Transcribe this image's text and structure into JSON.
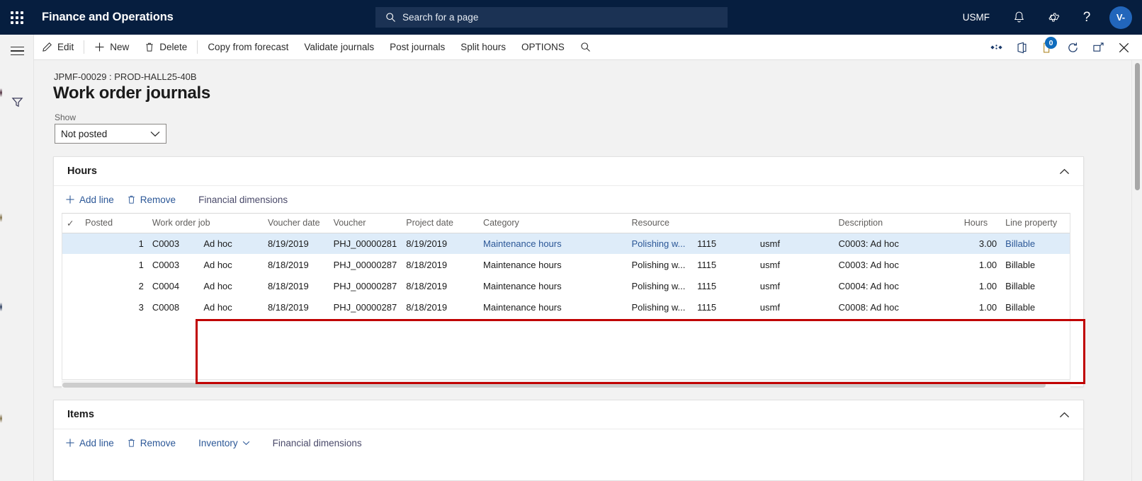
{
  "topnav": {
    "app_title": "Finance and Operations",
    "search_placeholder": "Search for a page",
    "company": "USMF",
    "icons": [
      "waffle-icon",
      "search-icon",
      "bell-icon",
      "gear-icon",
      "help-icon"
    ],
    "avatar_initials": "V-"
  },
  "commandbar": {
    "items": [
      {
        "label": "Edit",
        "icon": "pencil-icon"
      },
      {
        "label": "New",
        "icon": "plus-icon"
      },
      {
        "label": "Delete",
        "icon": "trash-icon"
      },
      {
        "label": "Copy from forecast",
        "icon": ""
      },
      {
        "label": "Validate journals",
        "icon": ""
      },
      {
        "label": "Post journals",
        "icon": ""
      },
      {
        "label": "Split hours",
        "icon": ""
      },
      {
        "label": "OPTIONS",
        "icon": ""
      }
    ],
    "right_icons": [
      "attachments-icon",
      "office-icon",
      "notes-icon",
      "refresh-icon",
      "popout-icon",
      "close-icon"
    ],
    "notes_badge": "0"
  },
  "page": {
    "breadcrumb": "JPMF-00029 : PROD-HALL25-40B",
    "title": "Work order journals",
    "show_label": "Show",
    "show_value": "Not posted"
  },
  "hours_section": {
    "title": "Hours",
    "toolbar": [
      {
        "label": "Add line",
        "icon": "plus-icon"
      },
      {
        "label": "Remove",
        "icon": "trash-icon"
      },
      {
        "label": "Financial dimensions",
        "icon": ""
      }
    ],
    "columns": [
      {
        "key": "check",
        "label": "✓"
      },
      {
        "key": "posted",
        "label": "Posted"
      },
      {
        "key": "line",
        "label": ""
      },
      {
        "key": "job",
        "label": "Work order job"
      },
      {
        "key": "adhoc",
        "label": ""
      },
      {
        "key": "voucher_date",
        "label": "Voucher date"
      },
      {
        "key": "voucher",
        "label": "Voucher"
      },
      {
        "key": "project_date",
        "label": "Project date"
      },
      {
        "key": "category",
        "label": "Category"
      },
      {
        "key": "resource",
        "label": "Resource"
      },
      {
        "key": "resource_num",
        "label": ""
      },
      {
        "key": "legal_entity",
        "label": ""
      },
      {
        "key": "description",
        "label": "Description"
      },
      {
        "key": "hours",
        "label": "Hours"
      },
      {
        "key": "line_property",
        "label": "Line property"
      }
    ],
    "rows": [
      {
        "selected": true,
        "line": "1",
        "job": "C0003",
        "adhoc": "Ad hoc",
        "voucher_date": "8/19/2019",
        "voucher": "PHJ_00000281",
        "project_date": "8/19/2019",
        "category": "Maintenance hours",
        "resource": "Polishing w...",
        "resource_num": "1115",
        "legal_entity": "usmf",
        "description": "C0003: Ad hoc",
        "hours": "3.00",
        "line_property": "Billable"
      },
      {
        "selected": false,
        "line": "1",
        "job": "C0003",
        "adhoc": "Ad hoc",
        "voucher_date": "8/18/2019",
        "voucher": "PHJ_00000287",
        "project_date": "8/18/2019",
        "category": "Maintenance hours",
        "resource": "Polishing w...",
        "resource_num": "1115",
        "legal_entity": "usmf",
        "description": "C0003: Ad hoc",
        "hours": "1.00",
        "line_property": "Billable"
      },
      {
        "selected": false,
        "line": "2",
        "job": "C0004",
        "adhoc": "Ad hoc",
        "voucher_date": "8/18/2019",
        "voucher": "PHJ_00000287",
        "project_date": "8/18/2019",
        "category": "Maintenance hours",
        "resource": "Polishing w...",
        "resource_num": "1115",
        "legal_entity": "usmf",
        "description": "C0004: Ad hoc",
        "hours": "1.00",
        "line_property": "Billable"
      },
      {
        "selected": false,
        "line": "3",
        "job": "C0008",
        "adhoc": "Ad hoc",
        "voucher_date": "8/18/2019",
        "voucher": "PHJ_00000287",
        "project_date": "8/18/2019",
        "category": "Maintenance hours",
        "resource": "Polishing w...",
        "resource_num": "1115",
        "legal_entity": "usmf",
        "description": "C0008: Ad hoc",
        "hours": "1.00",
        "line_property": "Billable"
      }
    ]
  },
  "items_section": {
    "title": "Items",
    "toolbar": [
      {
        "label": "Add line",
        "icon": "plus-icon"
      },
      {
        "label": "Remove",
        "icon": "trash-icon"
      },
      {
        "label": "Inventory",
        "icon": "chevron-down-icon"
      },
      {
        "label": "Financial dimensions",
        "icon": ""
      }
    ]
  },
  "colors": {
    "nav_bg": "#061e3f",
    "link": "#2b5797",
    "selected_row": "#deecf9",
    "annotation": "#c00000",
    "badge": "#0f6cbd"
  }
}
